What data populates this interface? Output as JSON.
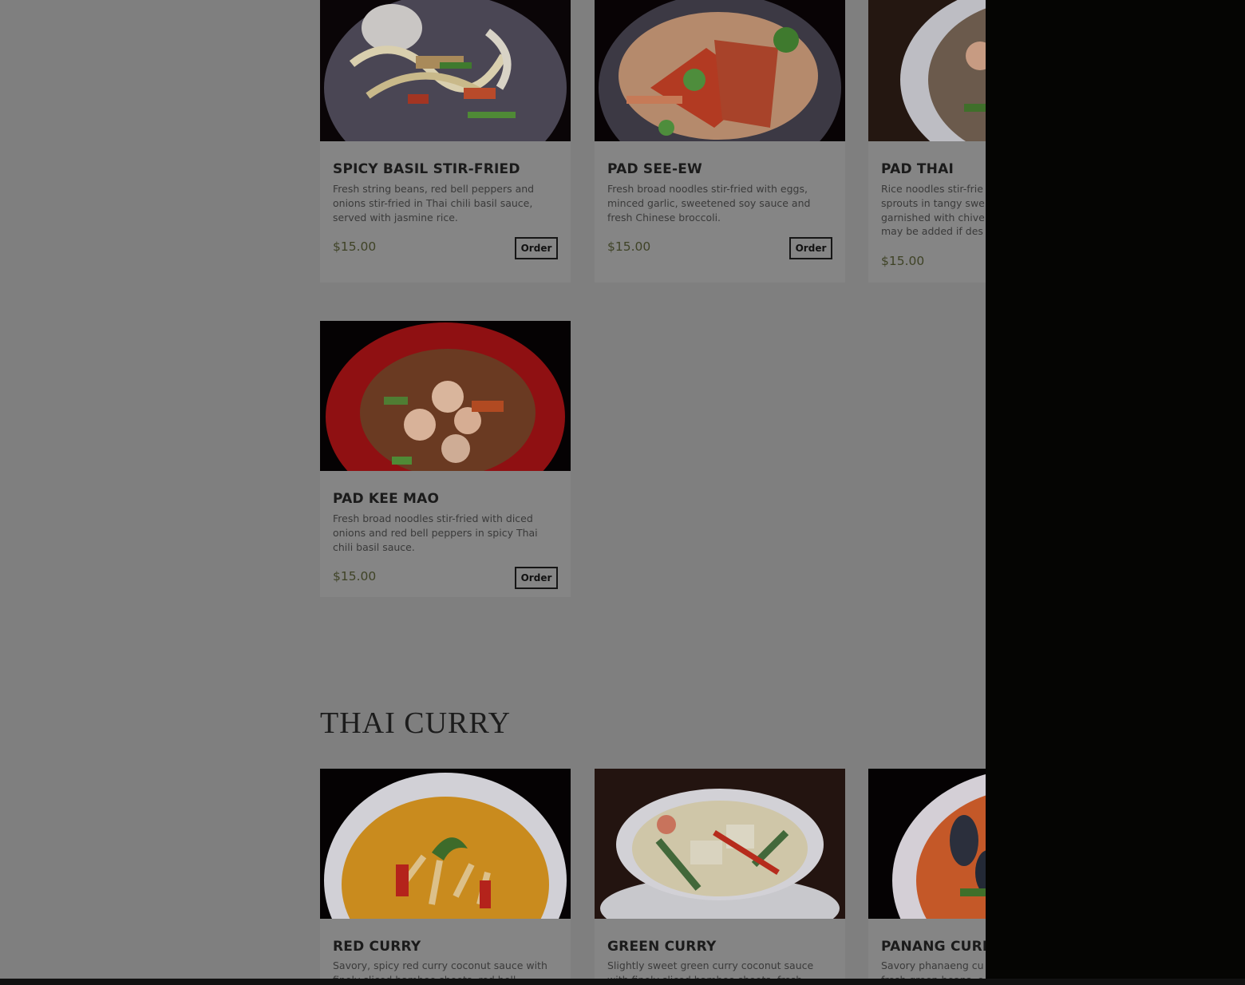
{
  "currency_note": "",
  "menu": {
    "noodles": [
      {
        "name": "SPICY BASIL STIR-FRIED",
        "description": "Fresh string beans, red bell peppers and onions stir-fried in Thai chili basil sauce, served with jasmine rice.",
        "price": "$15.00",
        "order_label": "Order"
      },
      {
        "name": "PAD SEE-EW",
        "description": "Fresh broad noodles stir-fried with eggs, minced garlic, sweetened soy sauce and fresh Chinese broccoli.",
        "price": "$15.00",
        "order_label": "Order"
      },
      {
        "name": "PAD THAI",
        "description": "Rice noodles stir-frie sprouts in tangy swe garnished with chive may be added if des",
        "price": "$15.00"
      },
      {
        "name": "PAD KEE MAO",
        "description": "Fresh broad noodles stir-fried with diced onions and red bell peppers in spicy Thai chili basil sauce.",
        "price": "$15.00",
        "order_label": "Order"
      }
    ],
    "curry_section_title": "THAI CURRY",
    "curry": [
      {
        "name": "RED CURRY",
        "description": "Savory, spicy red curry coconut sauce with finely sliced bamboo shoots, red bell"
      },
      {
        "name": "GREEN CURRY",
        "description": "Slightly sweet green curry coconut sauce with finely sliced bamboo shoots, fresh"
      },
      {
        "name": "PANANG CURR",
        "description": "Savory phanaeng cu fresh green beans, o"
      }
    ]
  },
  "colors": {
    "overlay_bg": "#7f7f7f",
    "card_bg": "#858585",
    "drawer_bg": "#050503",
    "price_text": "#3f4326"
  }
}
